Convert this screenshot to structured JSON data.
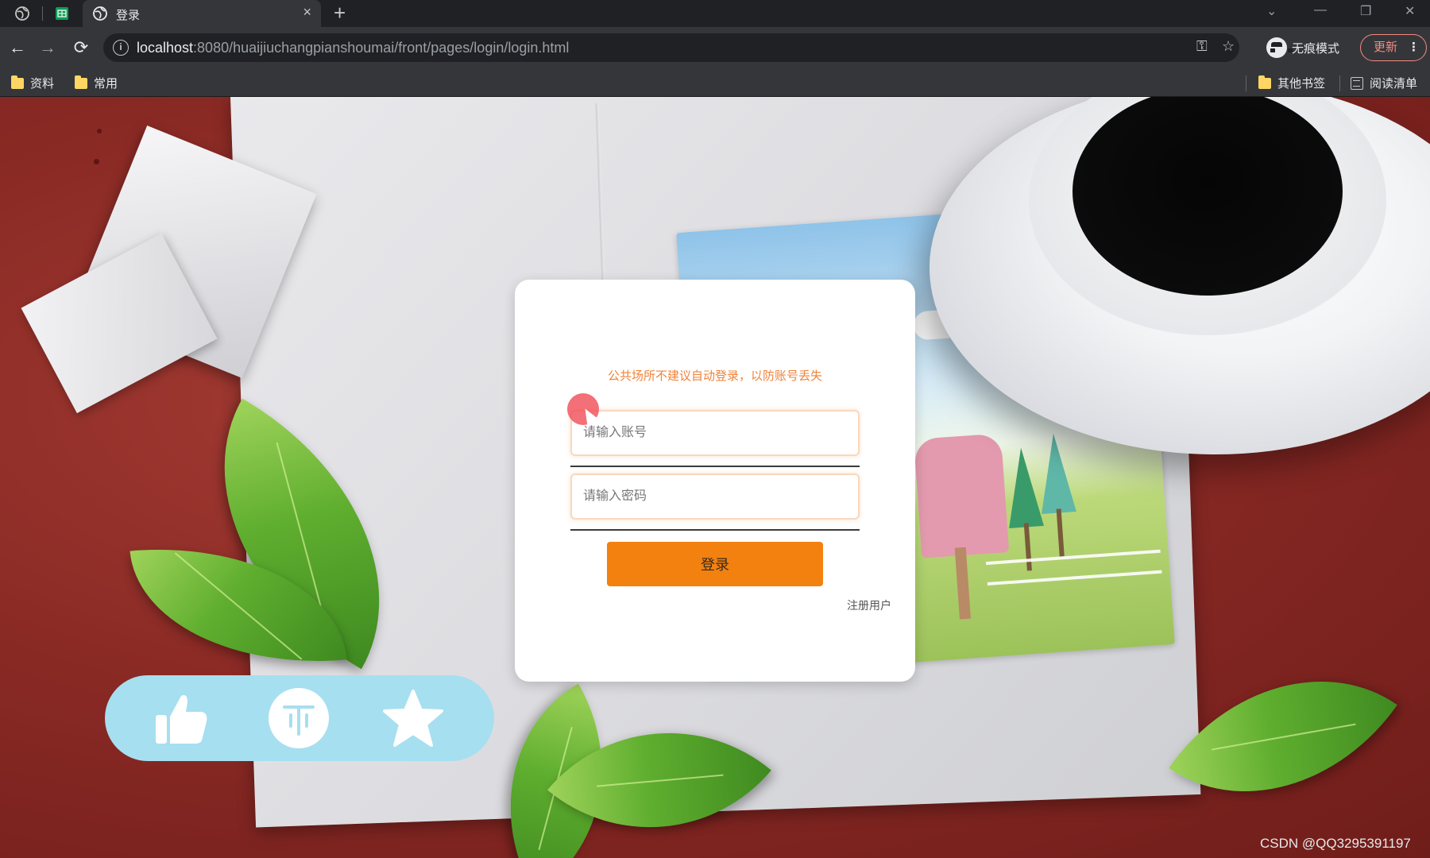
{
  "browser": {
    "tab": {
      "title": "登录",
      "close_glyph": "×"
    },
    "new_tab_glyph": "+",
    "nav": {
      "back": "←",
      "forward": "→",
      "reload": "⟳"
    },
    "url": {
      "host": "localhost",
      "rest": ":8080/huaijiuchangpianshoumai/front/pages/login/login.html"
    },
    "incognito_label": "无痕模式",
    "update_label": "更新",
    "menu_glyph": "⋮",
    "bookmarks": {
      "left": [
        "资料",
        "常用"
      ],
      "other": "其他书签",
      "reading_list": "阅读清单"
    }
  },
  "login": {
    "notice": "公共场所不建议自动登录，以防账号丢失",
    "account_placeholder": "请输入账号",
    "password_placeholder": "请输入密码",
    "login_button": "登录",
    "register_link": "注册用户",
    "accent_color": "#f3810f",
    "notice_color": "#f0833a"
  },
  "social": {
    "icons": [
      "thumbs-up-icon",
      "coin-icon",
      "star-icon"
    ],
    "background": "#a6dff0"
  },
  "watermark": "CSDN @QQ3295391197"
}
